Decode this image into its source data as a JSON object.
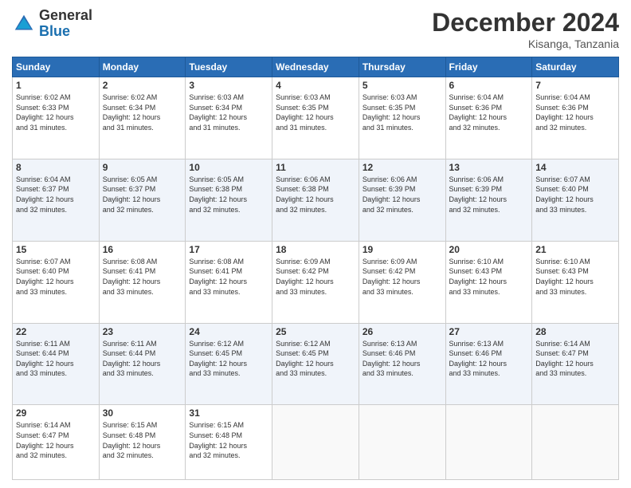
{
  "header": {
    "logo_general": "General",
    "logo_blue": "Blue",
    "month_title": "December 2024",
    "location": "Kisanga, Tanzania"
  },
  "weekdays": [
    "Sunday",
    "Monday",
    "Tuesday",
    "Wednesday",
    "Thursday",
    "Friday",
    "Saturday"
  ],
  "weeks": [
    [
      {
        "day": "1",
        "info": "Sunrise: 6:02 AM\nSunset: 6:33 PM\nDaylight: 12 hours\nand 31 minutes."
      },
      {
        "day": "2",
        "info": "Sunrise: 6:02 AM\nSunset: 6:34 PM\nDaylight: 12 hours\nand 31 minutes."
      },
      {
        "day": "3",
        "info": "Sunrise: 6:03 AM\nSunset: 6:34 PM\nDaylight: 12 hours\nand 31 minutes."
      },
      {
        "day": "4",
        "info": "Sunrise: 6:03 AM\nSunset: 6:35 PM\nDaylight: 12 hours\nand 31 minutes."
      },
      {
        "day": "5",
        "info": "Sunrise: 6:03 AM\nSunset: 6:35 PM\nDaylight: 12 hours\nand 31 minutes."
      },
      {
        "day": "6",
        "info": "Sunrise: 6:04 AM\nSunset: 6:36 PM\nDaylight: 12 hours\nand 32 minutes."
      },
      {
        "day": "7",
        "info": "Sunrise: 6:04 AM\nSunset: 6:36 PM\nDaylight: 12 hours\nand 32 minutes."
      }
    ],
    [
      {
        "day": "8",
        "info": "Sunrise: 6:04 AM\nSunset: 6:37 PM\nDaylight: 12 hours\nand 32 minutes."
      },
      {
        "day": "9",
        "info": "Sunrise: 6:05 AM\nSunset: 6:37 PM\nDaylight: 12 hours\nand 32 minutes."
      },
      {
        "day": "10",
        "info": "Sunrise: 6:05 AM\nSunset: 6:38 PM\nDaylight: 12 hours\nand 32 minutes."
      },
      {
        "day": "11",
        "info": "Sunrise: 6:06 AM\nSunset: 6:38 PM\nDaylight: 12 hours\nand 32 minutes."
      },
      {
        "day": "12",
        "info": "Sunrise: 6:06 AM\nSunset: 6:39 PM\nDaylight: 12 hours\nand 32 minutes."
      },
      {
        "day": "13",
        "info": "Sunrise: 6:06 AM\nSunset: 6:39 PM\nDaylight: 12 hours\nand 32 minutes."
      },
      {
        "day": "14",
        "info": "Sunrise: 6:07 AM\nSunset: 6:40 PM\nDaylight: 12 hours\nand 33 minutes."
      }
    ],
    [
      {
        "day": "15",
        "info": "Sunrise: 6:07 AM\nSunset: 6:40 PM\nDaylight: 12 hours\nand 33 minutes."
      },
      {
        "day": "16",
        "info": "Sunrise: 6:08 AM\nSunset: 6:41 PM\nDaylight: 12 hours\nand 33 minutes."
      },
      {
        "day": "17",
        "info": "Sunrise: 6:08 AM\nSunset: 6:41 PM\nDaylight: 12 hours\nand 33 minutes."
      },
      {
        "day": "18",
        "info": "Sunrise: 6:09 AM\nSunset: 6:42 PM\nDaylight: 12 hours\nand 33 minutes."
      },
      {
        "day": "19",
        "info": "Sunrise: 6:09 AM\nSunset: 6:42 PM\nDaylight: 12 hours\nand 33 minutes."
      },
      {
        "day": "20",
        "info": "Sunrise: 6:10 AM\nSunset: 6:43 PM\nDaylight: 12 hours\nand 33 minutes."
      },
      {
        "day": "21",
        "info": "Sunrise: 6:10 AM\nSunset: 6:43 PM\nDaylight: 12 hours\nand 33 minutes."
      }
    ],
    [
      {
        "day": "22",
        "info": "Sunrise: 6:11 AM\nSunset: 6:44 PM\nDaylight: 12 hours\nand 33 minutes."
      },
      {
        "day": "23",
        "info": "Sunrise: 6:11 AM\nSunset: 6:44 PM\nDaylight: 12 hours\nand 33 minutes."
      },
      {
        "day": "24",
        "info": "Sunrise: 6:12 AM\nSunset: 6:45 PM\nDaylight: 12 hours\nand 33 minutes."
      },
      {
        "day": "25",
        "info": "Sunrise: 6:12 AM\nSunset: 6:45 PM\nDaylight: 12 hours\nand 33 minutes."
      },
      {
        "day": "26",
        "info": "Sunrise: 6:13 AM\nSunset: 6:46 PM\nDaylight: 12 hours\nand 33 minutes."
      },
      {
        "day": "27",
        "info": "Sunrise: 6:13 AM\nSunset: 6:46 PM\nDaylight: 12 hours\nand 33 minutes."
      },
      {
        "day": "28",
        "info": "Sunrise: 6:14 AM\nSunset: 6:47 PM\nDaylight: 12 hours\nand 33 minutes."
      }
    ],
    [
      {
        "day": "29",
        "info": "Sunrise: 6:14 AM\nSunset: 6:47 PM\nDaylight: 12 hours\nand 32 minutes."
      },
      {
        "day": "30",
        "info": "Sunrise: 6:15 AM\nSunset: 6:48 PM\nDaylight: 12 hours\nand 32 minutes."
      },
      {
        "day": "31",
        "info": "Sunrise: 6:15 AM\nSunset: 6:48 PM\nDaylight: 12 hours\nand 32 minutes."
      },
      {
        "day": "",
        "info": ""
      },
      {
        "day": "",
        "info": ""
      },
      {
        "day": "",
        "info": ""
      },
      {
        "day": "",
        "info": ""
      }
    ]
  ]
}
